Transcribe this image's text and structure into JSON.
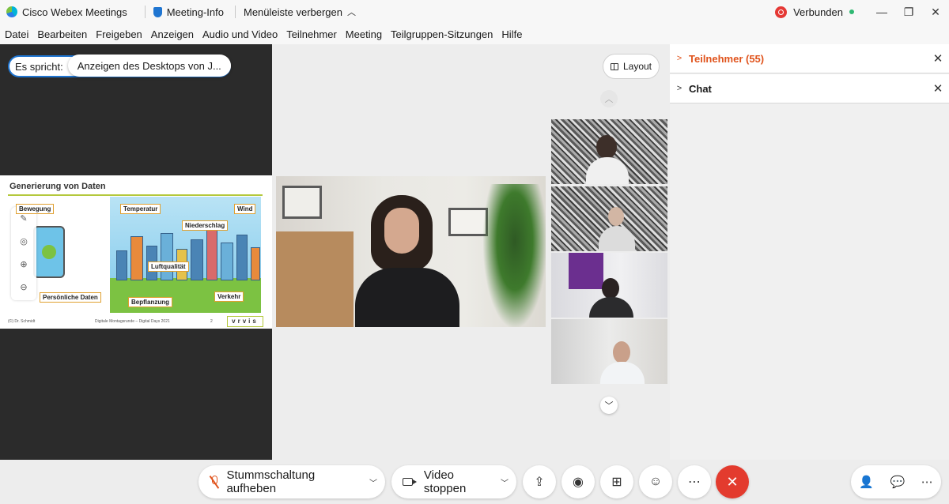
{
  "titlebar": {
    "app_name": "Cisco Webex Meetings",
    "meeting_info": "Meeting-Info",
    "hide_menu": "Menüleiste verbergen",
    "status": "Verbunden"
  },
  "menu": [
    "Datei",
    "Bearbeiten",
    "Freigeben",
    "Anzeigen",
    "Audio und Video",
    "Teilnehmer",
    "Meeting",
    "Teilgruppen-Sitzungen",
    "Hilfe"
  ],
  "share": {
    "speaking_label": "Es spricht:",
    "desktop_label": "Anzeigen des Desktops von J..."
  },
  "slide": {
    "title": "Generierung von Daten",
    "tags": {
      "bewegung": "Bewegung",
      "persoenlich": "Persönliche Daten",
      "temperatur": "Temperatur",
      "wind": "Wind",
      "niederschlag": "Niederschlag",
      "luftqualitaet": "Luftqualität",
      "verkehr": "Verkehr",
      "bepflanzung": "Bepflanzung"
    },
    "footer_left": "(©) Dr. Schmidt",
    "footer_center": "Digitale Montagsrunde – Digital Days 2021",
    "page": "2",
    "logo": "vrvis"
  },
  "layout_button": "Layout",
  "panel": {
    "participants": "Teilnehmer (55)",
    "chat": "Chat"
  },
  "toolbar": {
    "unmute": "Stummschaltung aufheben",
    "stop_video": "Video stoppen",
    "more": "⋯"
  },
  "colors": {
    "accent": "#e0531c",
    "end_call": "#e33b2e",
    "connected": "#2eb872",
    "share_bg": "#2b2b2b"
  }
}
